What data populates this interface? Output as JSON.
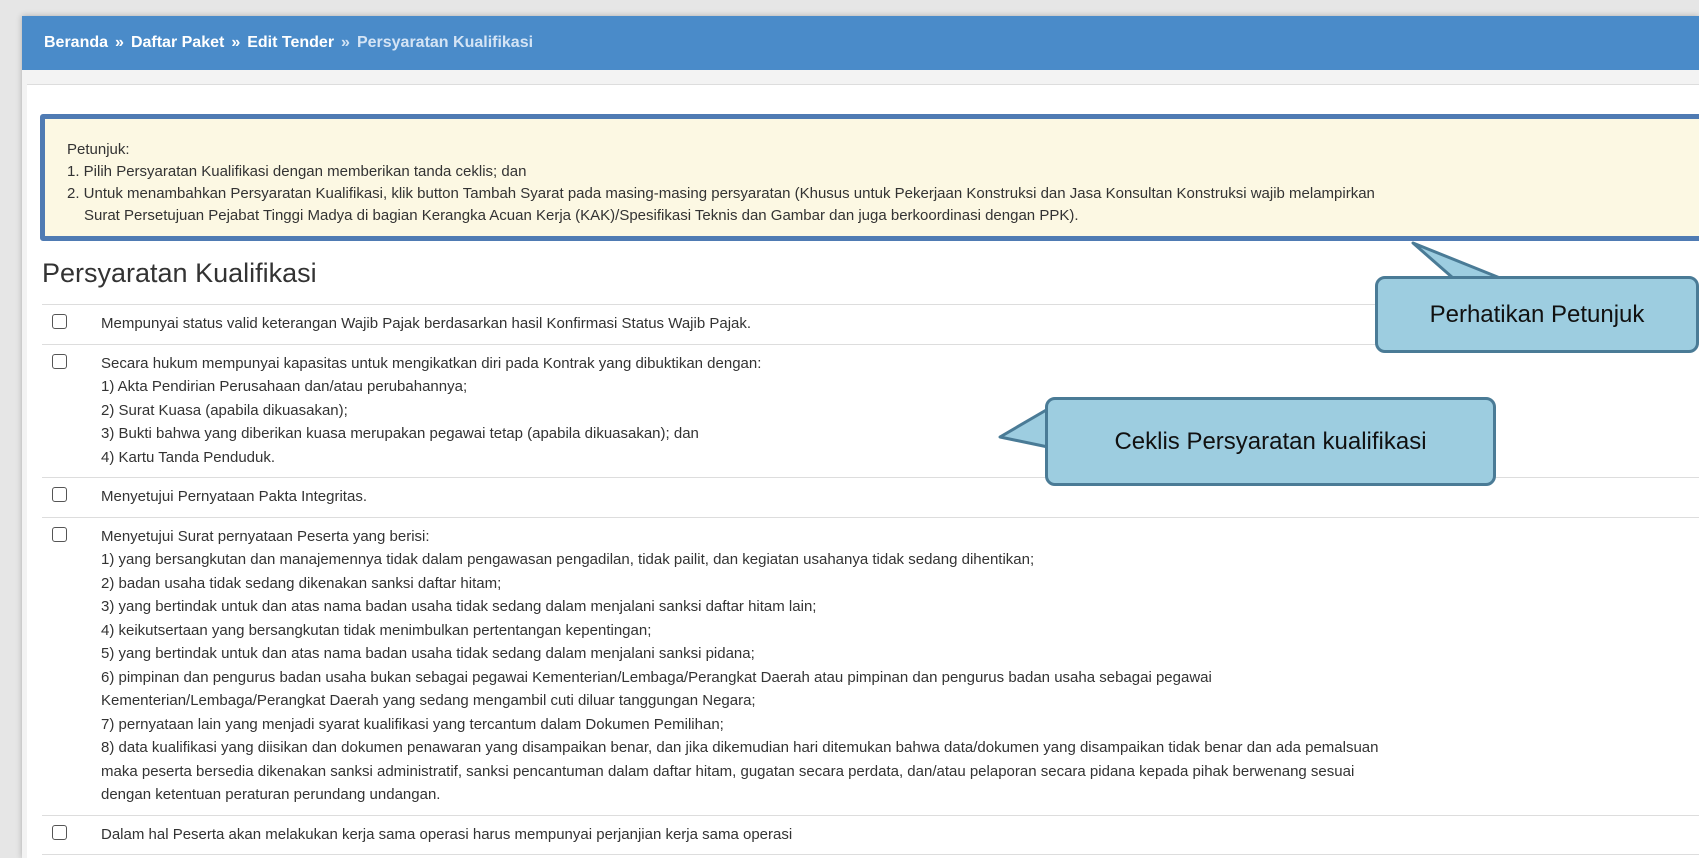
{
  "breadcrumb": {
    "items": [
      "Beranda",
      "Daftar Paket",
      "Edit Tender"
    ],
    "separator": "»",
    "current": "Persyaratan Kualifikasi"
  },
  "hint": {
    "title": "Petunjuk:",
    "item1": "1. Pilih Persyaratan Kualifikasi dengan memberikan tanda ceklis; dan",
    "item2_line1": "2. Untuk menambahkan Persyaratan Kualifikasi, klik button Tambah Syarat pada masing-masing persyaratan (Khusus untuk Pekerjaan Konstruksi dan Jasa Konsultan Konstruksi wajib melampirkan",
    "item2_line2": "Surat Persetujuan Pejabat Tinggi Madya di bagian Kerangka Acuan Kerja (KAK)/Spesifikasi Teknis dan Gambar dan juga berkoordinasi dengan PPK)."
  },
  "section_title": "Persyaratan Kualifikasi",
  "requirements": [
    {
      "lines": [
        "Mempunyai status valid keterangan Wajib Pajak berdasarkan hasil Konfirmasi Status Wajib Pajak."
      ]
    },
    {
      "lines": [
        "Secara hukum mempunyai kapasitas untuk mengikatkan diri pada Kontrak yang dibuktikan dengan:",
        "1) Akta Pendirian Perusahaan dan/atau perubahannya;",
        "2) Surat Kuasa (apabila dikuasakan);",
        "3) Bukti bahwa yang diberikan kuasa merupakan pegawai tetap (apabila dikuasakan); dan",
        "4) Kartu Tanda Penduduk."
      ]
    },
    {
      "lines": [
        "Menyetujui Pernyataan Pakta Integritas."
      ]
    },
    {
      "lines": [
        "Menyetujui Surat pernyataan Peserta yang berisi:",
        "1) yang bersangkutan dan manajemennya tidak dalam pengawasan pengadilan, tidak pailit, dan kegiatan usahanya tidak sedang dihentikan;",
        "2) badan usaha tidak sedang dikenakan sanksi daftar hitam;",
        "3) yang bertindak untuk dan atas nama badan usaha tidak sedang dalam menjalani sanksi daftar hitam lain;",
        "4) keikutsertaan yang bersangkutan tidak menimbulkan pertentangan kepentingan;",
        "5) yang bertindak untuk dan atas nama badan usaha tidak sedang dalam menjalani sanksi pidana;",
        "6) pimpinan dan pengurus badan usaha bukan sebagai pegawai Kementerian/Lembaga/Perangkat Daerah atau pimpinan dan pengurus badan usaha sebagai pegawai",
        "Kementerian/Lembaga/Perangkat Daerah yang sedang mengambil cuti diluar tanggungan Negara;",
        "7) pernyataan lain yang menjadi syarat kualifikasi yang tercantum dalam Dokumen Pemilihan;",
        "8) data kualifikasi yang diisikan dan dokumen penawaran yang disampaikan benar, dan jika dikemudian hari ditemukan bahwa data/dokumen yang disampaikan tidak benar dan ada pemalsuan",
        "maka peserta bersedia dikenakan sanksi administratif, sanksi pencantuman dalam daftar hitam, gugatan secara perdata, dan/atau pelaporan secara pidana kepada pihak berwenang sesuai",
        "dengan ketentuan peraturan perundang undangan."
      ]
    },
    {
      "lines": [
        "Dalam hal Peserta akan melakukan kerja sama operasi harus mempunyai perjanjian kerja sama operasi"
      ]
    }
  ],
  "callouts": {
    "hint_note": "Perhatikan Petunjuk",
    "checklist_note": "Ceklis Persyaratan kualifikasi"
  },
  "colors": {
    "header": "#4a8bc9",
    "hint_background": "#fcf8e3",
    "hint_border": "#4f7bb3",
    "callout_fill": "#9dcde0",
    "callout_border": "#4a7b96"
  }
}
